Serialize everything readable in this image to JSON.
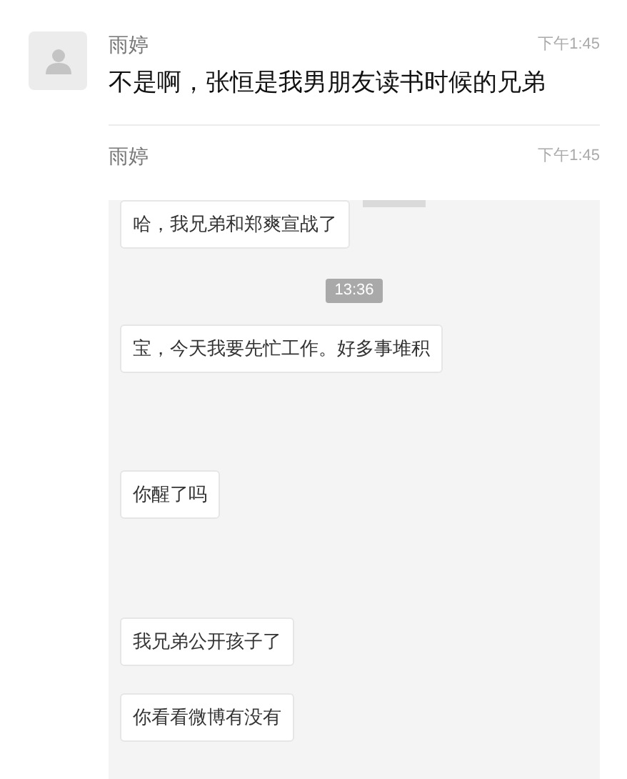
{
  "messages": [
    {
      "sender": "雨婷",
      "time": "下午1:45",
      "kind": "text",
      "text": "不是啊，张恒是我男朋友读书时候的兄弟"
    },
    {
      "sender": "雨婷",
      "time": "下午1:45",
      "kind": "screenshot",
      "items": [
        {
          "kind": "bubble",
          "text": "哈，我兄弟和郑爽宣战了"
        },
        {
          "kind": "time",
          "text": "13:36"
        },
        {
          "kind": "bubble",
          "text": "宝，今天我要先忙工作。好多事堆积"
        },
        {
          "kind": "bubble",
          "text": "你醒了吗"
        },
        {
          "kind": "bubble",
          "text": "我兄弟公开孩子了"
        },
        {
          "kind": "bubble",
          "text": "你看看微博有没有"
        }
      ]
    }
  ]
}
